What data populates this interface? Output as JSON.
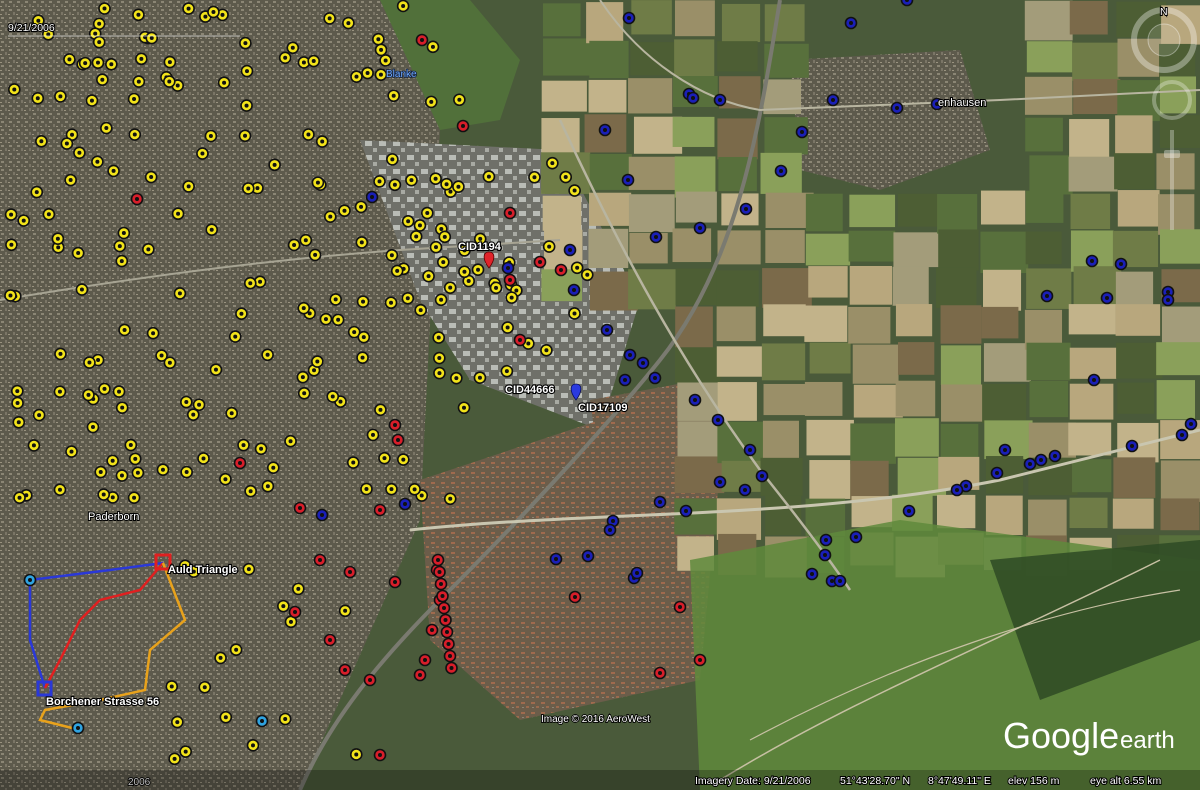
{
  "map": {
    "date_stamp": "9/21/2006",
    "bottom_date_stamp": "2006",
    "labels": {
      "blanke": "Blanke",
      "enhausen": "enhausen",
      "paderborn": "Paderborn",
      "cid1194": "CID1194",
      "cid44666": "CID44666",
      "cid17109": "CID17109",
      "auld_triangle": "Auld Triangle",
      "borchener": "Borchener Strasse 56"
    },
    "image_credit": "Image © 2016 AeroWest",
    "brand": {
      "google": "Google",
      "earth": "earth"
    },
    "compass_north": "N",
    "status_bar": {
      "imagery_date": "Imagery Date: 9/21/2006",
      "lat": "51°43'28.70\" N",
      "lon": "8°47'49.11\" E",
      "elev": "elev   156 m",
      "eye_alt": "eye alt  6.55 km"
    },
    "colors": {
      "yellow_marker": "#f2e31a",
      "red_marker": "#d81e2a",
      "blue_marker": "#1a1fb8",
      "route_red": "#e02020",
      "route_blue": "#2a38d8",
      "route_orange": "#e8a21c"
    },
    "icons": {
      "north": "compass-icon",
      "pin": "placemark-pin-icon",
      "square": "square-marker-icon"
    }
  }
}
